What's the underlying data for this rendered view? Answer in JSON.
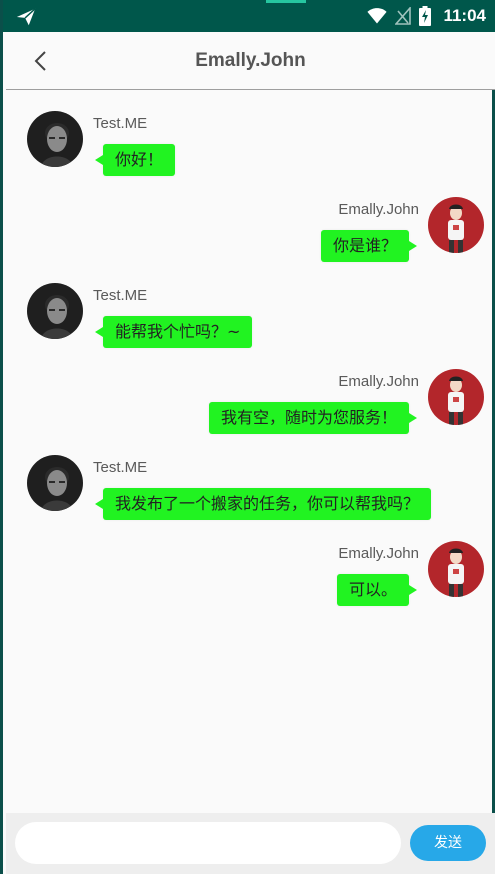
{
  "status_bar": {
    "time": "11:04",
    "icons": [
      "send-icon",
      "wifi-icon",
      "signal-off-icon",
      "battery-charging-icon"
    ]
  },
  "header": {
    "title": "Emally.John",
    "back_icon": "chevron-left-icon"
  },
  "messages": [
    {
      "side": "left",
      "name": "Test.ME",
      "text": "你好！"
    },
    {
      "side": "right",
      "name": "Emally.John",
      "text": "你是谁？"
    },
    {
      "side": "left",
      "name": "Test.ME",
      "text": "能帮我个忙吗？~"
    },
    {
      "side": "right",
      "name": "Emally.John",
      "text": "我有空，随时为您服务！"
    },
    {
      "side": "left",
      "name": "Test.ME",
      "text": "我发布了一个搬家的任务，你可以帮我吗？"
    },
    {
      "side": "right",
      "name": "Emally.John",
      "text": "可以。"
    }
  ],
  "input": {
    "value": "",
    "placeholder": "",
    "send_label": "发送"
  },
  "colors": {
    "status_bar": "#00574b",
    "bubble": "#21f321",
    "send_button": "#27a8e8",
    "right_avatar_bg": "#b3262b"
  }
}
